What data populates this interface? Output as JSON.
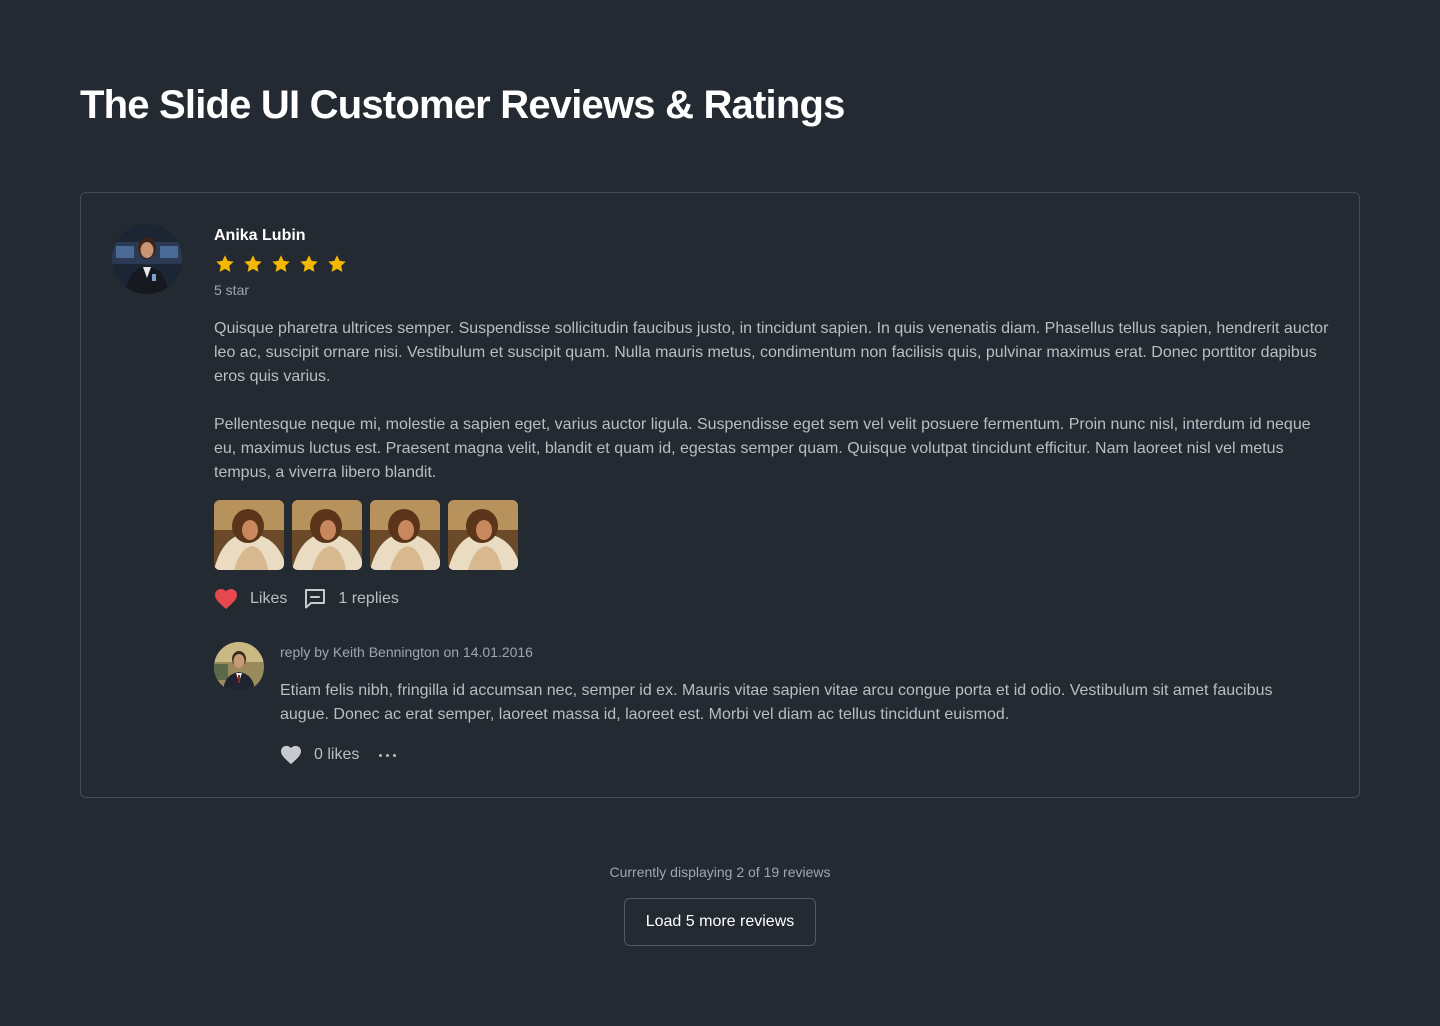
{
  "page": {
    "title": "The Slide UI Customer Reviews & Ratings"
  },
  "review": {
    "author": "Anika Lubin",
    "rating": 5,
    "rating_max": 5,
    "rating_label": "5 star",
    "paragraphs": [
      "Quisque pharetra ultrices semper. Suspendisse sollicitudin faucibus justo, in tincidunt sapien. In quis venenatis diam. Phasellus tellus sapien, hendrerit auctor leo ac, suscipit ornare nisi. Vestibulum et suscipit quam. Nulla mauris metus, condimentum non facilisis quis, pulvinar maximus erat. Donec porttitor dapibus eros quis varius.",
      "Pellentesque neque mi, molestie a sapien eget, varius auctor ligula. Suspendisse eget sem vel velit posuere fermentum. Proin nunc nisl, interdum id neque eu, maximus luctus est. Praesent magna velit, blandit et quam id, egestas semper quam. Quisque volutpat tincidunt efficitur. Nam laoreet nisl vel metus tempus, a viverra libero blandit."
    ],
    "photo_count": 4,
    "likes_label": "Likes",
    "replies_label": "1 replies",
    "liked": true,
    "reply": {
      "meta": "reply by Keith Bennington on 14.01.2016",
      "text": "Etiam felis nibh, fringilla id accumsan nec, semper id ex. Mauris vitae sapien vitae arcu congue porta et id odio. Vestibulum sit amet faucibus augue. Donec ac erat semper, laoreet massa id, laoreet est. Morbi vel diam ac tellus tincidunt euismod.",
      "likes_label": "0 likes",
      "liked": false
    }
  },
  "footer": {
    "count_text": "Currently displaying 2 of 19 reviews",
    "load_more_label": "Load 5 more reviews"
  },
  "colors": {
    "background": "#242a32",
    "star": "#f5b800",
    "heart_active": "#e5484d",
    "heart_inactive": "#c7cbd1",
    "border": "#444b55"
  },
  "icons": {
    "star": "star-icon",
    "like": "heart-icon",
    "replies": "comment-icon",
    "more": "more-horizontal-icon"
  }
}
